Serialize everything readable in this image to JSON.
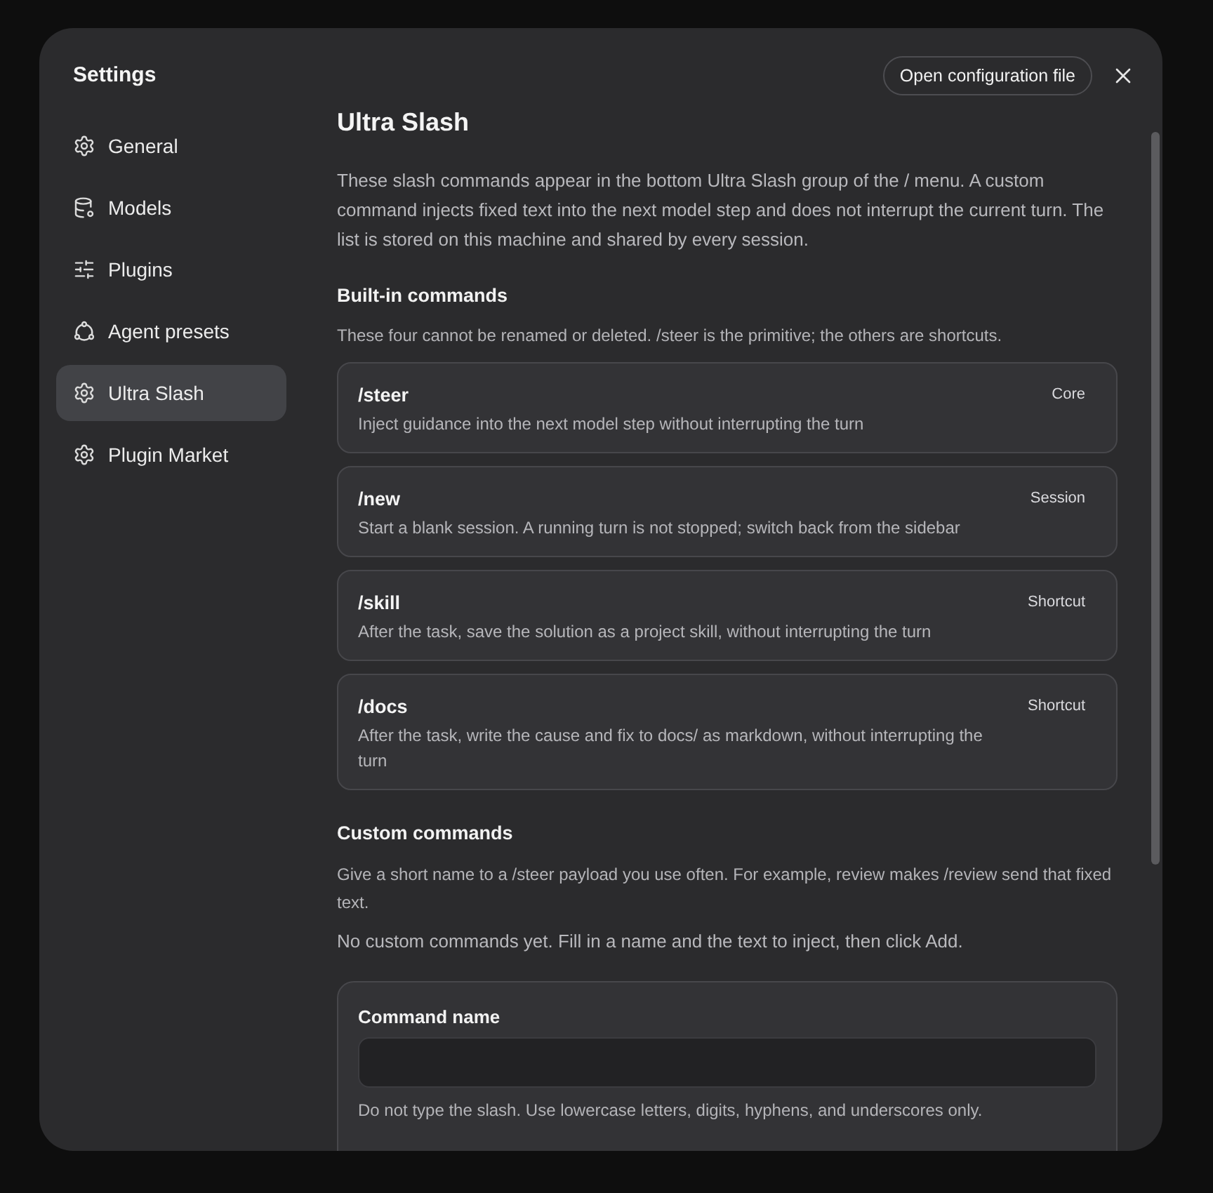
{
  "sidebar": {
    "title": "Settings",
    "items": [
      {
        "label": "General",
        "kind": "generic",
        "selected": false
      },
      {
        "label": "Models",
        "kind": "models",
        "selected": false
      },
      {
        "label": "Plugins",
        "kind": "plugins",
        "selected": false
      },
      {
        "label": "Agent presets",
        "kind": "agents",
        "selected": false
      },
      {
        "label": "Ultra Slash",
        "kind": "generic",
        "selected": true
      },
      {
        "label": "Plugin Market",
        "kind": "generic",
        "selected": false
      }
    ]
  },
  "header": {
    "button": "Open configuration file"
  },
  "page": {
    "title": "Ultra Slash",
    "intro": "These slash commands appear in the bottom Ultra Slash group of the / menu. A custom command injects fixed text into the next model step and does not interrupt the current turn. The list is stored on this machine and shared by every session.",
    "builtin": {
      "heading": "Built-in commands",
      "note": "These four cannot be renamed or deleted. /steer is the primitive; the others are shortcuts.",
      "commands": [
        {
          "name": "/steer",
          "description": "Inject guidance into the next model step without interrupting the turn",
          "tag": "Core"
        },
        {
          "name": "/new",
          "description": "Start a blank session. A running turn is not stopped; switch back from the sidebar",
          "tag": "Session"
        },
        {
          "name": "/skill",
          "description": "After the task, save the solution as a project skill, without interrupting the turn",
          "tag": "Shortcut"
        },
        {
          "name": "/docs",
          "description": "After the task, write the cause and fix to docs/ as markdown, without interrupting the turn",
          "tag": "Shortcut"
        }
      ]
    },
    "custom": {
      "heading": "Custom commands",
      "note": "Give a short name to a /steer payload you use often. For example, review makes /review send that fixed text.",
      "empty": "No custom commands yet. Fill in a name and the text to inject, then click Add.",
      "form": {
        "fields": [
          {
            "label": "Command name",
            "kind": "input",
            "hint": "Do not type the slash. Use lowercase letters, digits, hyphens, and underscores only."
          }
        ]
      }
    }
  }
}
